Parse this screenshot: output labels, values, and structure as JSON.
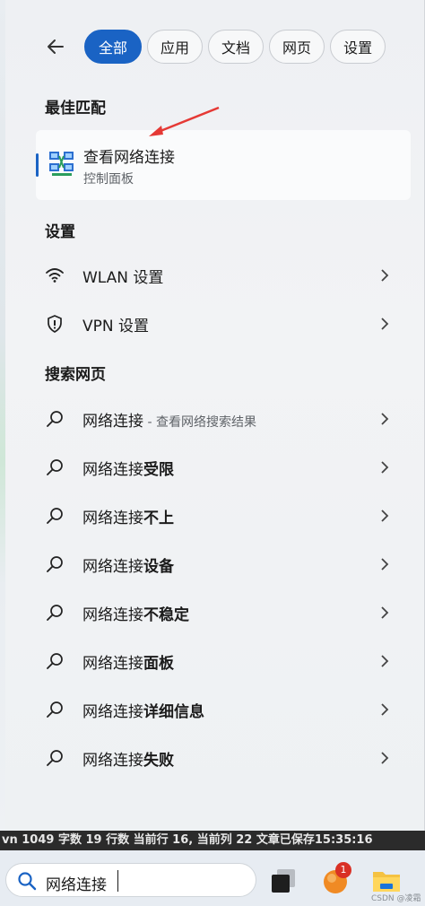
{
  "tabs": [
    "全部",
    "应用",
    "文档",
    "网页",
    "设置"
  ],
  "best_match": {
    "section": "最佳匹配",
    "title": "查看网络连接",
    "subtitle": "控制面板"
  },
  "settings": {
    "section": "设置",
    "items": [
      "WLAN 设置",
      "VPN 设置"
    ]
  },
  "web": {
    "section": "搜索网页",
    "first": {
      "prefix": "网络连接",
      "suffix": " - 查看网络搜索结果"
    },
    "items": [
      {
        "prefix": "网络连接",
        "bold": "受限"
      },
      {
        "prefix": "网络连接",
        "bold": "不上"
      },
      {
        "prefix": "网络连接",
        "bold": "设备"
      },
      {
        "prefix": "网络连接",
        "bold": "不稳定"
      },
      {
        "prefix": "网络连接",
        "bold": "面板"
      },
      {
        "prefix": "网络连接",
        "bold": "详细信息"
      },
      {
        "prefix": "网络连接",
        "bold": "失败"
      }
    ]
  },
  "status_bar": "vn  1049 字数  19 行数  当前行 16, 当前列 22  文章已保存15:35:16",
  "taskbar": {
    "search_value": "网络连接",
    "notification_count": "1",
    "watermark": "CSDN @凌霜"
  },
  "colors": {
    "accent": "#1a63c4",
    "badge": "#d93025"
  },
  "icons": [
    "back-arrow-icon",
    "network-connections-icon",
    "wifi-icon",
    "vpn-shield-icon",
    "search-icon",
    "chevron-right-icon",
    "app-icon",
    "folder-icon"
  ]
}
